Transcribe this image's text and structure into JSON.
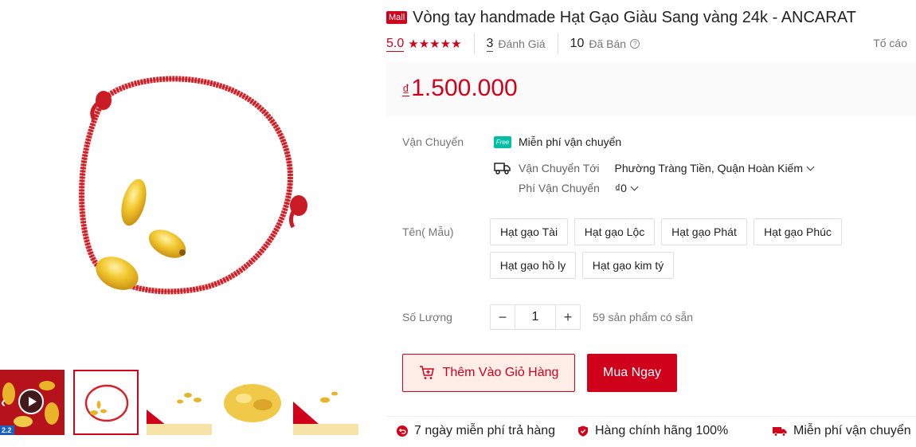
{
  "gallery": {
    "thumbnails": [
      {
        "name": "video-thumbnail",
        "badge": "2.2"
      },
      {
        "name": "bracelet-thumbnail"
      },
      {
        "name": "promo-thumbnail-1"
      },
      {
        "name": "rice-thumbnail"
      },
      {
        "name": "promo-thumbnail-2"
      }
    ]
  },
  "product": {
    "mall_badge": "Mall",
    "title": "Vòng tay handmade Hạt Gạo Giàu Sang vàng 24k - ANCARAT"
  },
  "rating": {
    "score": "5.0",
    "stars": 5,
    "reviews_count": "3",
    "reviews_label": "Đánh Giá",
    "sold_count": "10",
    "sold_label": "Đã Bán",
    "report_label": "Tố cáo"
  },
  "price": {
    "currency": "₫",
    "amount": "1.500.000"
  },
  "shipping": {
    "label": "Vận Chuyển",
    "free_icon_text": "Free",
    "free_text": "Miễn phí vận chuyển",
    "to_label": "Vận Chuyển Tới",
    "to_value": "Phường Tràng Tiền, Quận Hoàn Kiếm",
    "fee_label": "Phí Vận Chuyển",
    "fee_value": "₫0"
  },
  "variants": {
    "label": "Tên( Mẫu)",
    "options": [
      "Hạt gạo Tài",
      "Hạt gạo Lộc",
      "Hạt gạo Phát",
      "Hạt gạo Phúc",
      "Hạt gạo hồ ly",
      "Hạt gạo kim tý"
    ]
  },
  "quantity": {
    "label": "Số Lượng",
    "minus": "−",
    "value": "1",
    "plus": "+",
    "stock": "59 sản phẩm có sẵn"
  },
  "actions": {
    "add_to_cart": "Thêm Vào Giỏ Hàng",
    "buy_now": "Mua Ngay"
  },
  "guarantees": [
    "7 ngày miễn phí trả hàng",
    "Hàng chính hãng 100%",
    "Miễn phí vận chuyển"
  ],
  "colors": {
    "brand_red": "#d0011b",
    "free_ship_teal": "#00bfa5",
    "cord_red": "#d8232a",
    "gold": "#e8b52a"
  }
}
